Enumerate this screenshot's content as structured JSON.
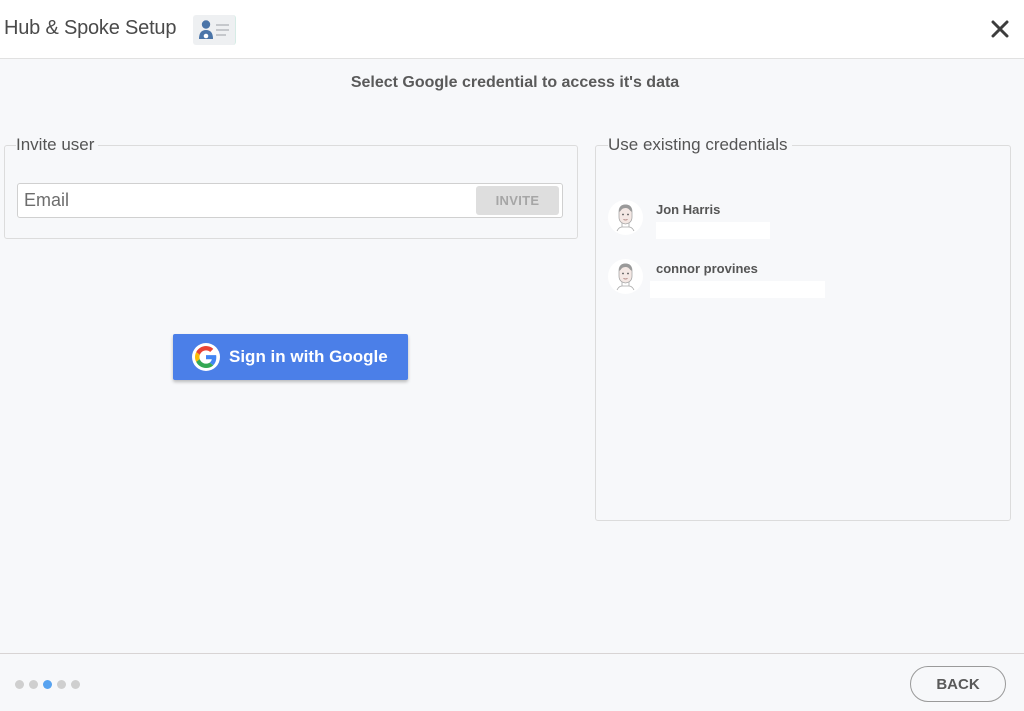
{
  "header": {
    "title": "Hub & Spoke Setup",
    "badge_icon": "user-list-icon",
    "close_icon": "close-icon"
  },
  "subtitle": "Select Google credential to access it's data",
  "invite": {
    "legend": "Invite user",
    "email_placeholder": "Email",
    "email_value": "",
    "invite_button": "INVITE"
  },
  "google": {
    "icon": "google-g-icon",
    "label": "Sign in with Google",
    "brand_color": "#4b7fe8"
  },
  "credentials": {
    "legend": "Use existing credentials",
    "items": [
      {
        "name": "Jon Harris",
        "avatar_icon": "user-avatar-icon"
      },
      {
        "name": "connor provines",
        "avatar_icon": "user-avatar-icon"
      }
    ]
  },
  "footer": {
    "steps_total": 5,
    "current_step": 3,
    "active_color": "#58a3f0",
    "back_button": "BACK"
  }
}
